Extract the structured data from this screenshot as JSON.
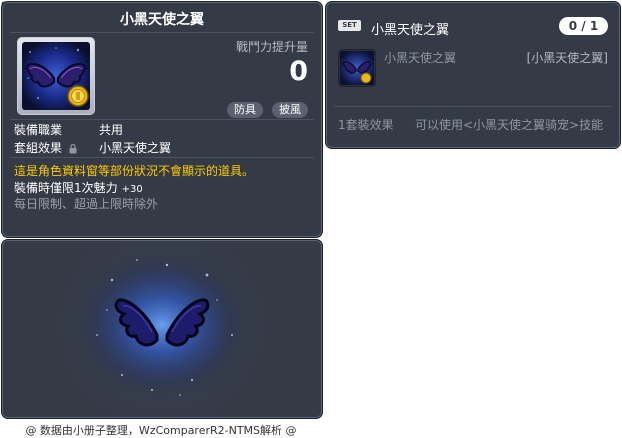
{
  "item_id": "01102980",
  "item": {
    "name": "小黑天使之翼",
    "power_label": "戰鬥力提升量",
    "power_value": "0",
    "tags": [
      "防具",
      "披風"
    ],
    "job_label": "裝備職業",
    "job_value": "共用",
    "set_label": "套組效果",
    "set_value": "小黑天使之翼",
    "description_warning": "這是角色資料窗等部份狀況不會顯示的道具。",
    "description_line": "裝備時僅限1次魅力",
    "description_bonus": "+30",
    "description_sub": "每日限制、超過上限時除外"
  },
  "set": {
    "badge": "SET",
    "title": "小黑天使之翼",
    "count": "0 / 1",
    "item_name": "小黑天使之翼",
    "item_type": "[小黑天使之翼]",
    "effect_label": "1套裝效果",
    "effect_text": "可以使用<小黑天使之翼骑宠>技能"
  },
  "footer": "@ 数据由小册子整理，WzComparerR2-NTMS解析 @",
  "colors": {
    "panel_bg": "#343a46",
    "warning_text": "#ffcc00",
    "muted_text": "#8f96a2",
    "wing_dark": "#1a1f6e",
    "wing_glow": "#3a8cff"
  },
  "icons": {
    "item": "black-angel-wings-icon",
    "coin": "gold-coin-icon",
    "lock": "lock-icon"
  }
}
